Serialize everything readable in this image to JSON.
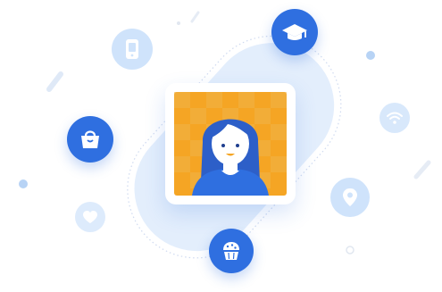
{
  "colors": {
    "accent_dark": "#2f6fe0",
    "accent_light": "#cfe3fb",
    "avatar_frame": "#ffffff",
    "avatar_bg": "#f5a524",
    "avatar_hair": "#2d5fc8",
    "avatar_skin": "#ffffff"
  },
  "icons": [
    "phone-icon",
    "graduation-cap-icon",
    "shopping-bag-icon",
    "wifi-icon",
    "location-pin-icon",
    "heart-icon",
    "cupcake-icon"
  ]
}
